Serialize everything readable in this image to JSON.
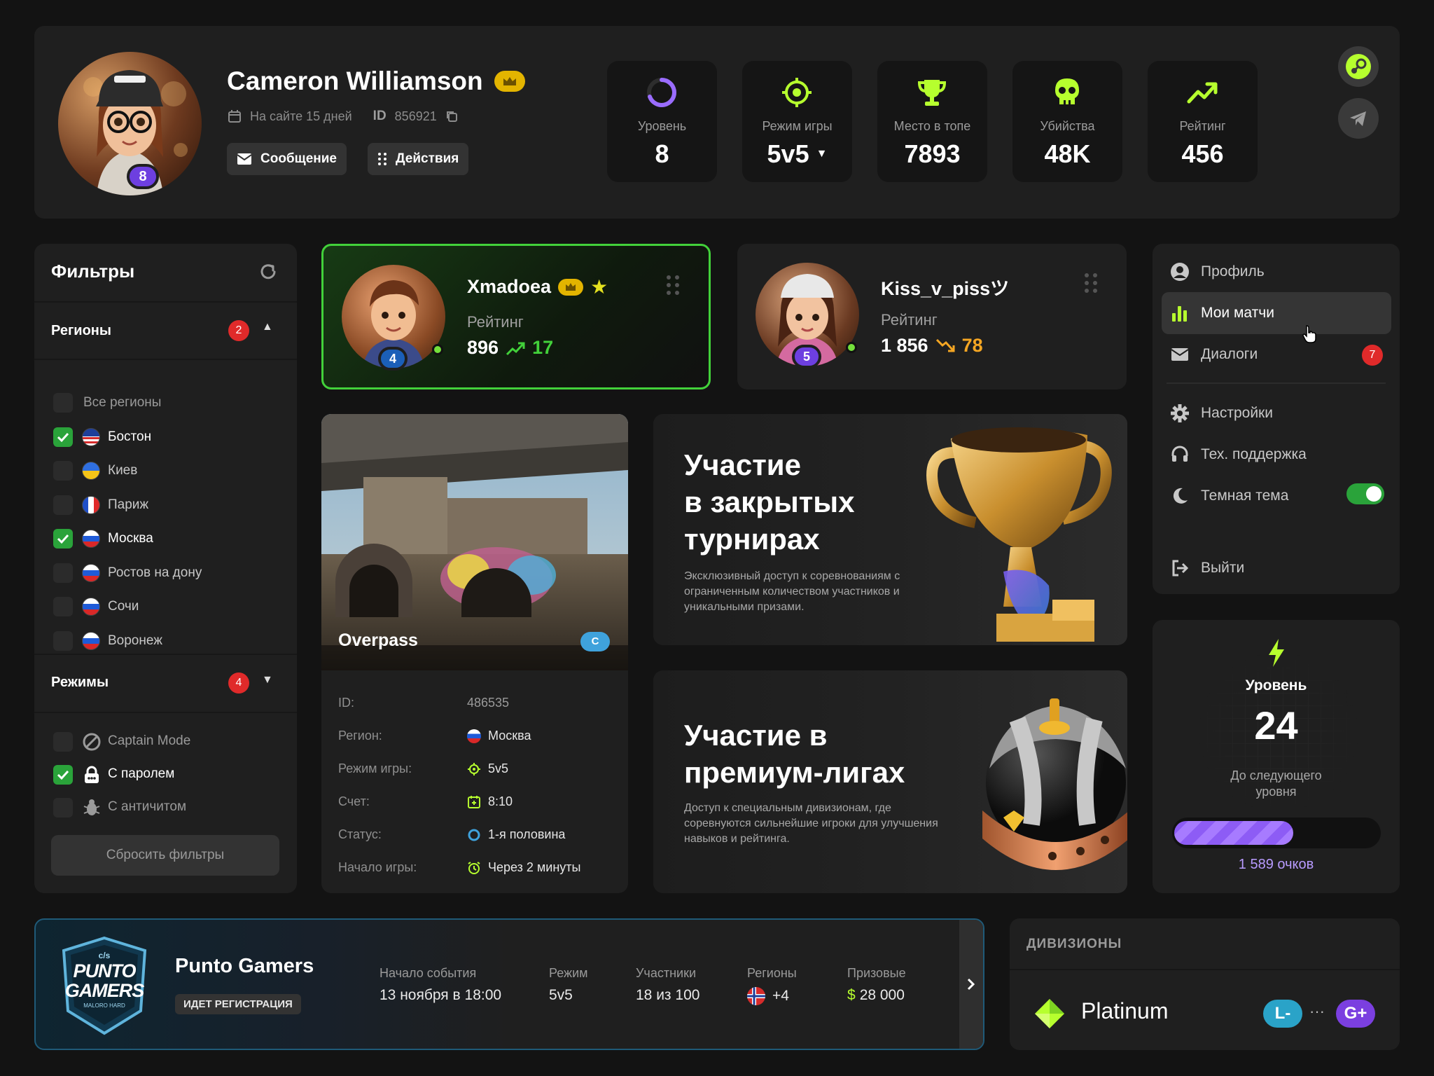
{
  "profile": {
    "name": "Cameron Williamson",
    "online_since": "На сайте 15 дней",
    "id_label": "ID",
    "id_value": "856921",
    "avatar_level": "8",
    "message_button": "Сообщение",
    "actions_button": "Действия"
  },
  "stats": [
    {
      "label": "Уровень",
      "value": "8",
      "icon": "level-ring-icon"
    },
    {
      "label": "Режим игры",
      "value": "5v5",
      "icon": "crosshair-icon"
    },
    {
      "label": "Место в топе",
      "value": "7893",
      "icon": "trophy-icon"
    },
    {
      "label": "Убийства",
      "value": "48K",
      "icon": "skull-icon"
    },
    {
      "label": "Рейтинг",
      "value": "456",
      "icon": "trend-up-icon"
    }
  ],
  "social": [
    "steam-icon",
    "telegram-icon"
  ],
  "filters": {
    "title": "Фильтры",
    "regions": {
      "title": "Регионы",
      "count": "2",
      "items": [
        {
          "label": "Все регионы",
          "checked": false,
          "flag": ""
        },
        {
          "label": "Бостон",
          "checked": true,
          "flag": "us"
        },
        {
          "label": "Киев",
          "checked": false,
          "flag": "ua"
        },
        {
          "label": "Париж",
          "checked": false,
          "flag": "fr"
        },
        {
          "label": "Москва",
          "checked": true,
          "flag": "ru"
        },
        {
          "label": "Ростов на дону",
          "checked": false,
          "flag": "ru"
        },
        {
          "label": "Сочи",
          "checked": false,
          "flag": "ru"
        },
        {
          "label": "Воронеж",
          "checked": false,
          "flag": "ru"
        }
      ]
    },
    "modes": {
      "title": "Режимы",
      "count": "4",
      "items": [
        {
          "label": "Captain Mode",
          "checked": false,
          "icon": "ban-icon"
        },
        {
          "label": "С паролем",
          "checked": true,
          "icon": "lock-icon"
        },
        {
          "label": "С античитом",
          "checked": false,
          "icon": "bug-icon"
        }
      ]
    },
    "reset_button": "Сбросить фильтры"
  },
  "players": [
    {
      "name": "Xmadoea",
      "rating_label": "Рейтинг",
      "rating": "896",
      "delta": "17",
      "trend": "up",
      "level": "4",
      "accent": "#42d13a"
    },
    {
      "name": "Kiss_v_pissツ",
      "rating_label": "Рейтинг",
      "rating": "1 856",
      "delta": "78",
      "trend": "down",
      "level": "5",
      "accent": "#f5a623"
    }
  ],
  "match": {
    "map": "Overpass",
    "map_badge": "C",
    "rows": [
      {
        "label": "ID:",
        "value": "486535",
        "icon": ""
      },
      {
        "label": "Регион:",
        "value": "Москва",
        "icon": "flag-ru-icon"
      },
      {
        "label": "Режим игры:",
        "value": "5v5",
        "icon": "crosshair-icon"
      },
      {
        "label": "Счет:",
        "value": "8:10",
        "icon": "score-icon"
      },
      {
        "label": "Статус:",
        "value": "1-я половина",
        "icon": "status-icon"
      },
      {
        "label": "Начало игры:",
        "value": "Через 2 минуты",
        "icon": "alarm-icon"
      }
    ]
  },
  "promos": [
    {
      "title_lines": [
        "Участие",
        "в закрытых",
        "турнирах"
      ],
      "text": "Эксклюзивный доступ к соревнованиям с ограниченным количеством участников и уникальными призами."
    },
    {
      "title_lines": [
        "Участие в",
        "премиум-лигах"
      ],
      "text": "Доступ к специальным дивизионам, где соревнуются сильнейшие игроки для улучшения навыков и рейтинга."
    }
  ],
  "menu": {
    "items": [
      {
        "label": "Профиль",
        "icon": "user-icon"
      },
      {
        "label": "Мои матчи",
        "icon": "bar-chart-icon"
      },
      {
        "label": "Диалоги",
        "icon": "mail-icon",
        "badge": "7"
      },
      {
        "label": "Настройки",
        "icon": "gear-icon"
      },
      {
        "label": "Тех. поддержка",
        "icon": "headset-icon"
      },
      {
        "label": "Темная тема",
        "icon": "moon-icon",
        "toggle": true
      },
      {
        "label": "Выйти",
        "icon": "logout-icon"
      }
    ]
  },
  "level_card": {
    "label": "Уровень",
    "value": "24",
    "next_label": "До следующего уровня",
    "points": "1 589 очков",
    "progress": 0.57
  },
  "event": {
    "logo_top": "c/s",
    "logo_line1": "PUNTO",
    "logo_line2": "GAMERS",
    "logo_bottom": "MALORO HARD",
    "title": "Punto Gamers",
    "status": "ИДЕТ РЕГИСТРАЦИЯ",
    "fields": [
      {
        "label": "Начало события",
        "value": "13 ноября в 18:00"
      },
      {
        "label": "Режим",
        "value": "5v5"
      },
      {
        "label": "Участники",
        "value": "18 из 100"
      },
      {
        "label": "Регионы",
        "value": "+4"
      },
      {
        "label": "Призовые",
        "value": "28 000",
        "currency": "$"
      }
    ]
  },
  "divisions": {
    "title": "ДИВИЗИОНЫ",
    "name": "Platinum",
    "from": "L-",
    "to": "G+",
    "dots": "···"
  }
}
